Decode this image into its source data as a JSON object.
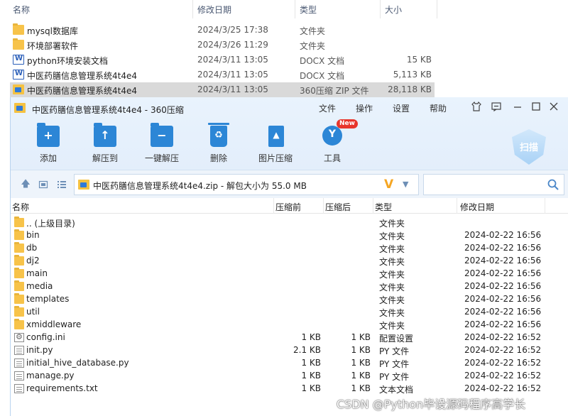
{
  "explorer": {
    "headers": {
      "name": "名称",
      "date": "修改日期",
      "type": "类型",
      "size": "大小"
    },
    "rows": [
      {
        "name": "mysql数据库",
        "date": "2024/3/25 17:38",
        "type": "文件夹",
        "size": "",
        "icon": "folder-icon"
      },
      {
        "name": "环境部署软件",
        "date": "2024/3/26 11:29",
        "type": "文件夹",
        "size": "",
        "icon": "folder-icon"
      },
      {
        "name": "python环境安装文档",
        "date": "2024/3/11 13:05",
        "type": "DOCX 文档",
        "size": "15 KB",
        "icon": "word-doc-icon"
      },
      {
        "name": "中医药膳信息管理系统4t4e4",
        "date": "2024/3/11 13:05",
        "type": "DOCX 文档",
        "size": "5,113 KB",
        "icon": "word-doc-icon"
      },
      {
        "name": "中医药膳信息管理系统4t4e4",
        "date": "2024/3/11 13:05",
        "type": "360压缩 ZIP 文件",
        "size": "28,118 KB",
        "icon": "zip-icon",
        "selected": true
      }
    ]
  },
  "zipwin": {
    "title": "中医药膳信息管理系统4t4e4 - 360压缩",
    "menu": {
      "file": "文件",
      "operate": "操作",
      "settings": "设置",
      "help": "帮助"
    },
    "toolbar": {
      "add": "添加",
      "extract_to": "解压到",
      "one_click_extract": "一键解压",
      "delete": "删除",
      "image_compress": "图片压缩",
      "tools": "工具",
      "new_badge": "New",
      "scan": "扫描"
    },
    "path": "中医药膳信息管理系统4t4e4.zip - 解包大小为 55.0 MB",
    "search_placeholder": "",
    "columns": {
      "name": "名称",
      "compressed": "压缩前",
      "uncompressed": "压缩后",
      "type": "类型",
      "date": "修改日期"
    },
    "rows": [
      {
        "name": ".. (上级目录)",
        "compressed": "",
        "uncompressed": "",
        "type": "文件夹",
        "date": "",
        "icon": "folder-icon"
      },
      {
        "name": "bin",
        "compressed": "",
        "uncompressed": "",
        "type": "文件夹",
        "date": "2024-02-22 16:56",
        "icon": "folder-icon"
      },
      {
        "name": "db",
        "compressed": "",
        "uncompressed": "",
        "type": "文件夹",
        "date": "2024-02-22 16:56",
        "icon": "folder-icon"
      },
      {
        "name": "dj2",
        "compressed": "",
        "uncompressed": "",
        "type": "文件夹",
        "date": "2024-02-22 16:56",
        "icon": "folder-icon"
      },
      {
        "name": "main",
        "compressed": "",
        "uncompressed": "",
        "type": "文件夹",
        "date": "2024-02-22 16:56",
        "icon": "folder-icon"
      },
      {
        "name": "media",
        "compressed": "",
        "uncompressed": "",
        "type": "文件夹",
        "date": "2024-02-22 16:56",
        "icon": "folder-icon"
      },
      {
        "name": "templates",
        "compressed": "",
        "uncompressed": "",
        "type": "文件夹",
        "date": "2024-02-22 16:56",
        "icon": "folder-icon"
      },
      {
        "name": "util",
        "compressed": "",
        "uncompressed": "",
        "type": "文件夹",
        "date": "2024-02-22 16:56",
        "icon": "folder-icon"
      },
      {
        "name": "xmiddleware",
        "compressed": "",
        "uncompressed": "",
        "type": "文件夹",
        "date": "2024-02-22 16:56",
        "icon": "folder-icon"
      },
      {
        "name": "config.ini",
        "compressed": "1 KB",
        "uncompressed": "1 KB",
        "type": "配置设置",
        "date": "2024-02-22 16:52",
        "icon": "settings-file-icon"
      },
      {
        "name": "init.py",
        "compressed": "2.1 KB",
        "uncompressed": "1 KB",
        "type": "PY 文件",
        "date": "2024-02-22 16:52",
        "icon": "file-icon"
      },
      {
        "name": "initial_hive_database.py",
        "compressed": "1 KB",
        "uncompressed": "1 KB",
        "type": "PY 文件",
        "date": "2024-02-22 16:52",
        "icon": "file-icon"
      },
      {
        "name": "manage.py",
        "compressed": "1 KB",
        "uncompressed": "1 KB",
        "type": "PY 文件",
        "date": "2024-02-22 16:52",
        "icon": "file-icon"
      },
      {
        "name": "requirements.txt",
        "compressed": "1 KB",
        "uncompressed": "1 KB",
        "type": "文本文档",
        "date": "2024-02-22 16:52",
        "icon": "file-icon"
      }
    ]
  },
  "watermark": "CSDN @Python毕设源码程序高学长",
  "colors": {
    "accent": "#2c86d6",
    "titlebar": "#e9f3fd",
    "selected_row": "#d9d9d9",
    "new_badge": "#e8352b"
  }
}
